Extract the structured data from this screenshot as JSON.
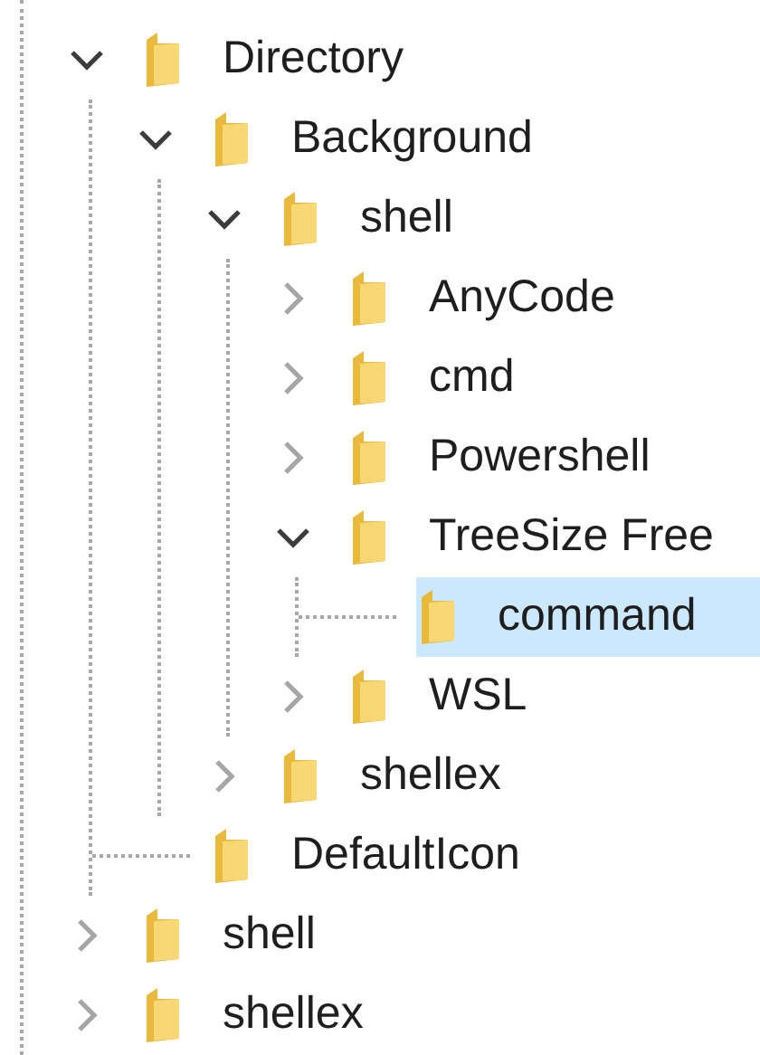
{
  "tree": {
    "items": [
      {
        "label": "Directory",
        "kind": "node",
        "expanded": true,
        "selected": false,
        "children": [
          {
            "label": "Background",
            "kind": "node",
            "expanded": true,
            "selected": false,
            "children": [
              {
                "label": "shell",
                "kind": "node",
                "expanded": true,
                "selected": false,
                "children": [
                  {
                    "label": "AnyCode",
                    "kind": "node",
                    "expanded": false,
                    "selected": false
                  },
                  {
                    "label": "cmd",
                    "kind": "node",
                    "expanded": false,
                    "selected": false
                  },
                  {
                    "label": "Powershell",
                    "kind": "node",
                    "expanded": false,
                    "selected": false
                  },
                  {
                    "label": "TreeSize Free",
                    "kind": "node",
                    "expanded": true,
                    "selected": false,
                    "children": [
                      {
                        "label": "command",
                        "kind": "leaf",
                        "selected": true
                      }
                    ]
                  },
                  {
                    "label": "WSL",
                    "kind": "node",
                    "expanded": false,
                    "selected": false
                  }
                ]
              },
              {
                "label": "shellex",
                "kind": "node",
                "expanded": false,
                "selected": false
              }
            ]
          },
          {
            "label": "DefaultIcon",
            "kind": "leaf",
            "selected": false
          }
        ]
      },
      {
        "label": "shell",
        "kind": "node",
        "expanded": false,
        "selected": false
      },
      {
        "label": "shellex",
        "kind": "node",
        "expanded": false,
        "selected": false
      }
    ]
  }
}
